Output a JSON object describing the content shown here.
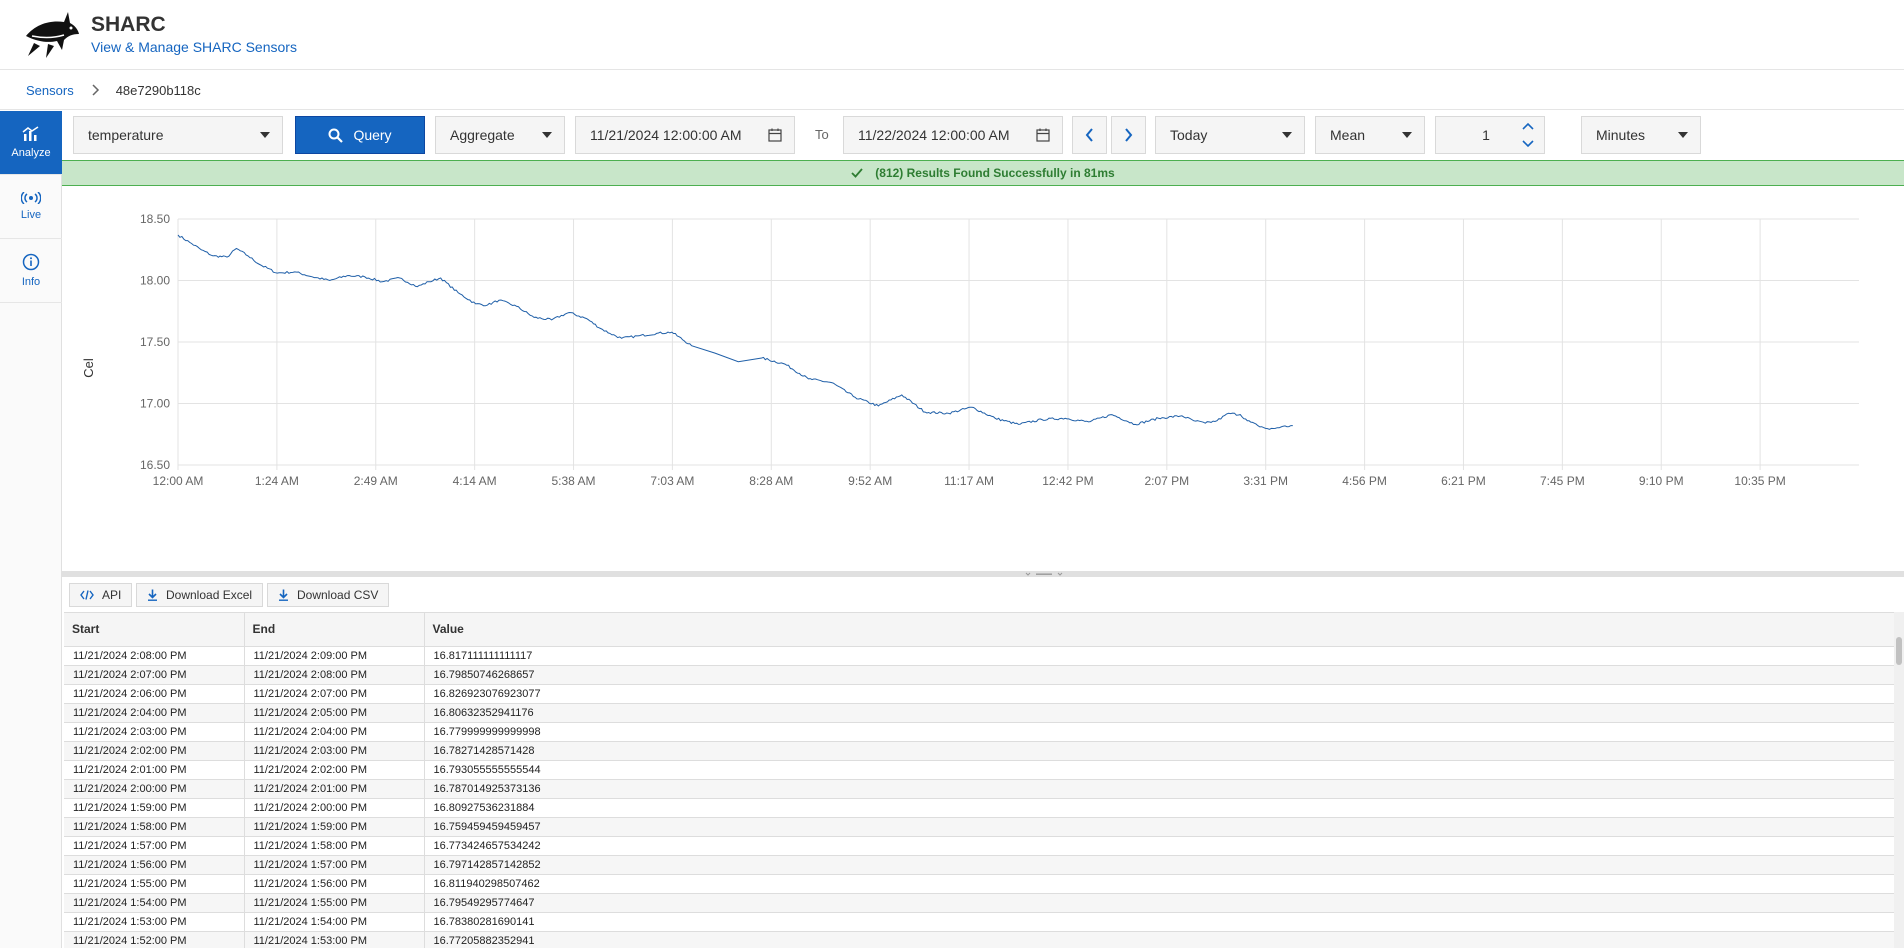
{
  "header": {
    "title": "SHARC",
    "subtitle": "View & Manage SHARC Sensors"
  },
  "breadcrumb": {
    "root": "Sensors",
    "current": "48e7290b118c"
  },
  "sidebar": {
    "items": [
      {
        "label": "Analyze",
        "active": true,
        "icon": "bar-chart-icon"
      },
      {
        "label": "Live",
        "active": false,
        "icon": "broadcast-icon"
      },
      {
        "label": "Info",
        "active": false,
        "icon": "info-icon"
      }
    ]
  },
  "toolbar": {
    "measurement": "temperature",
    "query_label": "Query",
    "mode": "Aggregate",
    "from": "11/21/2024 12:00:00 AM",
    "to_label": "To",
    "to": "11/22/2024 12:00:00 AM",
    "range": "Today",
    "aggregate_fn": "Mean",
    "interval_value": "1",
    "interval_unit": "Minutes"
  },
  "status": {
    "message": "(812) Results Found Successfully in 81ms",
    "color": "#2e7d32"
  },
  "chart_data": {
    "type": "line",
    "ylabel": "Cel",
    "ylim": [
      16.5,
      18.5
    ],
    "yticks": [
      "18.50",
      "18.00",
      "17.50",
      "17.00",
      "16.50"
    ],
    "xtick_labels": [
      "12:00 AM",
      "1:24 AM",
      "2:49 AM",
      "4:14 AM",
      "5:38 AM",
      "7:03 AM",
      "8:28 AM",
      "9:52 AM",
      "11:17 AM",
      "12:42 PM",
      "2:07 PM",
      "3:31 PM",
      "4:56 PM",
      "6:21 PM",
      "7:45 PM",
      "9:10 PM",
      "10:35 PM"
    ],
    "x_unit": "minutes since 12:00 AM",
    "xlim": [
      0,
      1440
    ],
    "series": [
      {
        "color": "#1f5fa8",
        "x": [
          0,
          10,
          20,
          30,
          42,
          50,
          60,
          70,
          85,
          100,
          115,
          130,
          145,
          160,
          175,
          190,
          205,
          215,
          225,
          240,
          255,
          265,
          275,
          290,
          305,
          320,
          335,
          350,
          362,
          370,
          380,
          395,
          410,
          423,
          440,
          460,
          480,
          500,
          520,
          540,
          560,
          580,
          600,
          620,
          640,
          660,
          680,
          700,
          720,
          740,
          760,
          780,
          800,
          820,
          840,
          860,
          870,
          880,
          890,
          900,
          910,
          916,
          925,
          935,
          945,
          955
        ],
        "y": [
          18.37,
          18.31,
          18.25,
          18.2,
          18.19,
          18.26,
          18.2,
          18.13,
          18.06,
          18.07,
          18.03,
          18.0,
          18.04,
          18.03,
          17.99,
          18.02,
          17.95,
          17.99,
          18.02,
          17.9,
          17.81,
          17.8,
          17.84,
          17.79,
          17.7,
          17.68,
          17.74,
          17.69,
          17.61,
          17.57,
          17.53,
          17.55,
          17.57,
          17.58,
          17.47,
          17.41,
          17.34,
          17.37,
          17.32,
          17.2,
          17.17,
          17.05,
          16.98,
          17.07,
          16.93,
          16.92,
          16.97,
          16.88,
          16.83,
          16.87,
          16.88,
          16.85,
          16.91,
          16.83,
          16.88,
          16.9,
          16.86,
          16.84,
          16.86,
          16.92,
          16.91,
          16.86,
          16.82,
          16.79,
          16.81,
          16.82
        ]
      }
    ]
  },
  "grid_toolbar": {
    "api_label": "API",
    "excel_label": "Download Excel",
    "csv_label": "Download CSV"
  },
  "table": {
    "columns": [
      "Start",
      "End",
      "Value"
    ],
    "rows": [
      [
        "11/21/2024 2:08:00 PM",
        "11/21/2024 2:09:00 PM",
        "16.817111111111117"
      ],
      [
        "11/21/2024 2:07:00 PM",
        "11/21/2024 2:08:00 PM",
        "16.79850746268657"
      ],
      [
        "11/21/2024 2:06:00 PM",
        "11/21/2024 2:07:00 PM",
        "16.826923076923077"
      ],
      [
        "11/21/2024 2:04:00 PM",
        "11/21/2024 2:05:00 PM",
        "16.80632352941176"
      ],
      [
        "11/21/2024 2:03:00 PM",
        "11/21/2024 2:04:00 PM",
        "16.779999999999998"
      ],
      [
        "11/21/2024 2:02:00 PM",
        "11/21/2024 2:03:00 PM",
        "16.78271428571428"
      ],
      [
        "11/21/2024 2:01:00 PM",
        "11/21/2024 2:02:00 PM",
        "16.793055555555544"
      ],
      [
        "11/21/2024 2:00:00 PM",
        "11/21/2024 2:01:00 PM",
        "16.787014925373136"
      ],
      [
        "11/21/2024 1:59:00 PM",
        "11/21/2024 2:00:00 PM",
        "16.80927536231884"
      ],
      [
        "11/21/2024 1:58:00 PM",
        "11/21/2024 1:59:00 PM",
        "16.759459459459457"
      ],
      [
        "11/21/2024 1:57:00 PM",
        "11/21/2024 1:58:00 PM",
        "16.773424657534242"
      ],
      [
        "11/21/2024 1:56:00 PM",
        "11/21/2024 1:57:00 PM",
        "16.797142857142852"
      ],
      [
        "11/21/2024 1:55:00 PM",
        "11/21/2024 1:56:00 PM",
        "16.811940298507462"
      ],
      [
        "11/21/2024 1:54:00 PM",
        "11/21/2024 1:55:00 PM",
        "16.79549295774647"
      ],
      [
        "11/21/2024 1:53:00 PM",
        "11/21/2024 1:54:00 PM",
        "16.78380281690141"
      ],
      [
        "11/21/2024 1:52:00 PM",
        "11/21/2024 1:53:00 PM",
        "16.77205882352941"
      ]
    ]
  }
}
